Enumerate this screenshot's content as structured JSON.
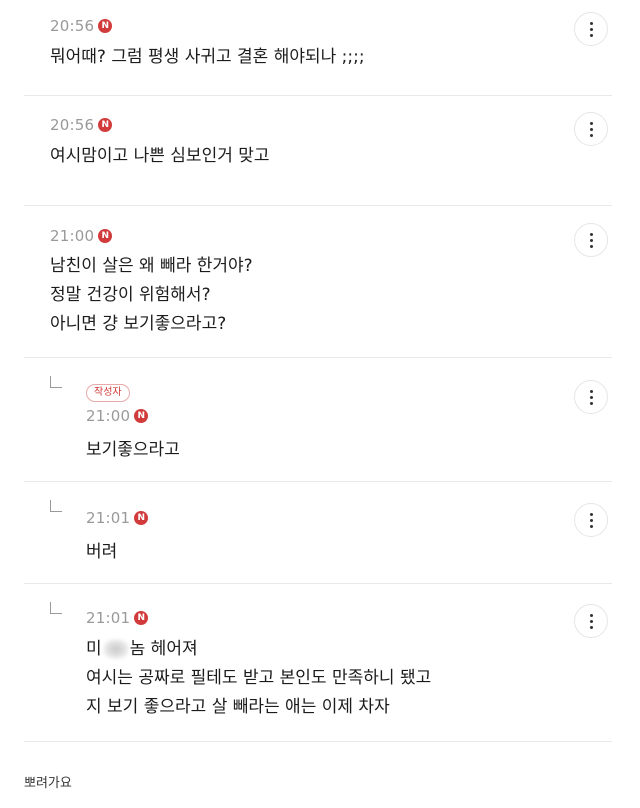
{
  "comments": [
    {
      "time": "20:56",
      "badge": "N",
      "lines": [
        "뭐어때? 그럼 평생 사귀고 결혼 해야되나 ;;;;"
      ]
    },
    {
      "time": "20:56",
      "badge": "N",
      "lines": [
        "여시맘이고 나쁜 심보인거 맞고"
      ]
    },
    {
      "time": "21:00",
      "badge": "N",
      "lines": [
        "남친이 살은 왜 빼라 한거야?",
        "정말 건강이 위험해서?",
        "아니면 걍 보기좋으라고?"
      ]
    }
  ],
  "replies": [
    {
      "author_tag": "작성자",
      "time": "21:00",
      "badge": "N",
      "lines": [
        "보기좋으라고"
      ]
    },
    {
      "time": "21:01",
      "badge": "N",
      "lines": [
        "버려"
      ]
    },
    {
      "time": "21:01",
      "badge": "N",
      "line1_prefix": "미",
      "line1_suffix": "놈 헤어져",
      "lines": [
        "여시는 공짜로 필테도 받고 본인도 만족하니 됐고",
        "지 보기 좋으라고 살 빼라는 애는 이제 차자"
      ]
    }
  ],
  "footer": {
    "text": "뽀려가요"
  },
  "icons": {
    "more": "more-vertical-icon",
    "reply": "reply-arrow-icon"
  },
  "colors": {
    "badge": "#d13b3b",
    "time": "#999999",
    "divider": "#e9e9e9"
  }
}
